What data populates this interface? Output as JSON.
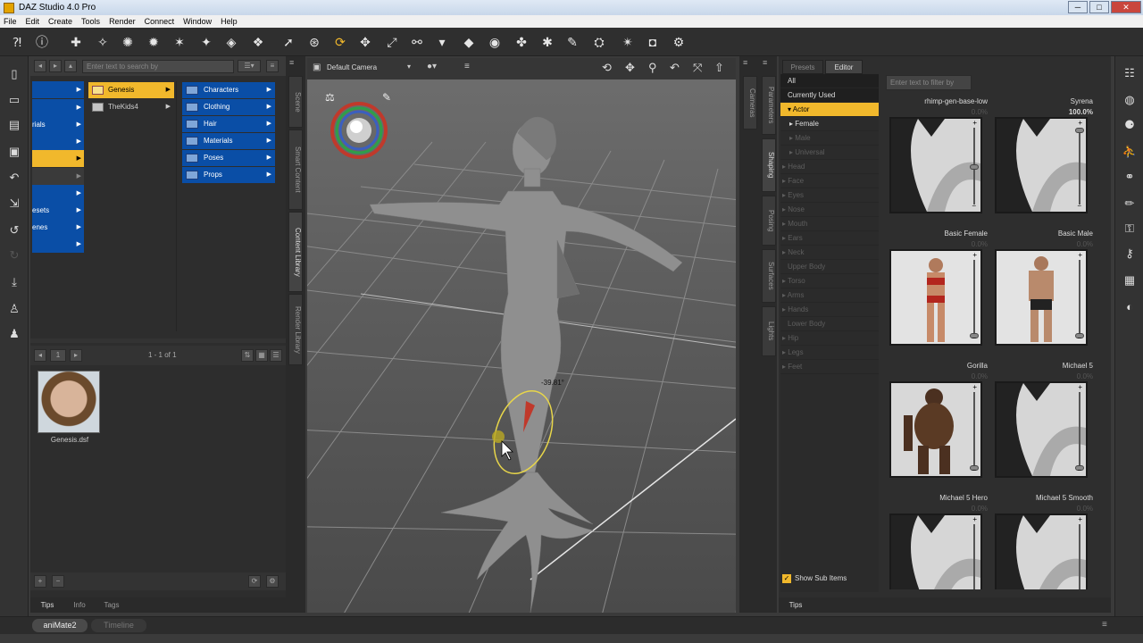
{
  "window": {
    "title": "DAZ Studio 4.0 Pro",
    "minimize": "─",
    "maximize": "□",
    "close": "✕"
  },
  "menu": [
    "File",
    "Edit",
    "Create",
    "Tools",
    "Render",
    "Connect",
    "Window",
    "Help"
  ],
  "content_library": {
    "search_placeholder": "Enter text to search by",
    "col1_items": [
      "",
      "",
      "rials",
      "",
      "",
      "",
      "",
      "esets",
      "enes",
      ""
    ],
    "col2_items": [
      {
        "label": "Genesis",
        "selected": true
      },
      {
        "label": "TheKids4",
        "selected": false
      }
    ],
    "col3_items": [
      "Characters",
      "Clothing",
      "Hair",
      "Materials",
      "Poses",
      "Props"
    ],
    "page_number": "1",
    "page_info": "1 - 1 of 1",
    "thumb_label": "Genesis.dsf",
    "add_btn": "+",
    "remove_btn": "−",
    "bottom_tabs": [
      "Tips",
      "Info",
      "Tags"
    ]
  },
  "left_vtabs": [
    "Scene",
    "Smart Content",
    "Content Library",
    "Render Library"
  ],
  "viewport": {
    "camera": "Default Camera",
    "angle_readout": "-39.81°"
  },
  "right_vtabs_1": [
    "Cameras"
  ],
  "right_vtabs_2": [
    "Parameters",
    "Shaping",
    "Posing",
    "Surfaces",
    "Lights"
  ],
  "shaping": {
    "tabs": [
      "Presets",
      "Editor"
    ],
    "active_tab": "Editor",
    "filter_placeholder": "Enter text to filter by",
    "rows": [
      {
        "label": "All",
        "style": "dark"
      },
      {
        "label": "Currently Used",
        "style": "dark"
      },
      {
        "label": "▾ Actor",
        "style": "hl"
      },
      {
        "label": "▸ Female",
        "style": ""
      },
      {
        "label": "▸ Male",
        "style": "dim"
      },
      {
        "label": "▸ Universal",
        "style": "dim"
      },
      {
        "label": "▸ Head",
        "style": "dim"
      },
      {
        "label": "▸ Face",
        "style": "dim"
      },
      {
        "label": "▸ Eyes",
        "style": "dim"
      },
      {
        "label": "▸ Nose",
        "style": "dim"
      },
      {
        "label": "▸ Mouth",
        "style": "dim"
      },
      {
        "label": "▸ Ears",
        "style": "dim"
      },
      {
        "label": "▸ Neck",
        "style": "dim"
      },
      {
        "label": "Upper Body",
        "style": "dim"
      },
      {
        "label": "▸ Torso",
        "style": "dim"
      },
      {
        "label": "▸ Arms",
        "style": "dim"
      },
      {
        "label": "▸ Hands",
        "style": "dim"
      },
      {
        "label": "Lower Body",
        "style": "dim"
      },
      {
        "label": "▸ Hip",
        "style": "dim"
      },
      {
        "label": "▸ Legs",
        "style": "dim"
      },
      {
        "label": "▸ Feet",
        "style": "dim"
      }
    ],
    "show_sub_items": "Show Sub Items",
    "morphs": [
      {
        "name": "rhimp-gen-base-low",
        "value": "0.0%",
        "level": 0.5,
        "dim": true,
        "img": "swirl"
      },
      {
        "name": "Syrena",
        "value": "100.0%",
        "level": 1.0,
        "dim": false,
        "img": "swirl"
      },
      {
        "name": "Basic Female",
        "value": "0.0%",
        "level": 0.0,
        "dim": true,
        "img": "female"
      },
      {
        "name": "Basic Male",
        "value": "0.0%",
        "level": 0.0,
        "dim": true,
        "img": "male"
      },
      {
        "name": "Gorilla",
        "value": "0.0%",
        "level": 0.0,
        "dim": true,
        "img": "gorilla"
      },
      {
        "name": "Michael 5",
        "value": "0.0%",
        "level": 0.0,
        "dim": true,
        "img": "swirl"
      },
      {
        "name": "Michael 5 Hero",
        "value": "0.0%",
        "level": 0.0,
        "dim": true,
        "img": "swirl"
      },
      {
        "name": "Michael 5 Smooth",
        "value": "0.0%",
        "level": 0.0,
        "dim": true,
        "img": "swirl"
      }
    ],
    "bottom_tab": "Tips"
  },
  "bottom_tabs": [
    "aniMate2",
    "Timeline"
  ]
}
